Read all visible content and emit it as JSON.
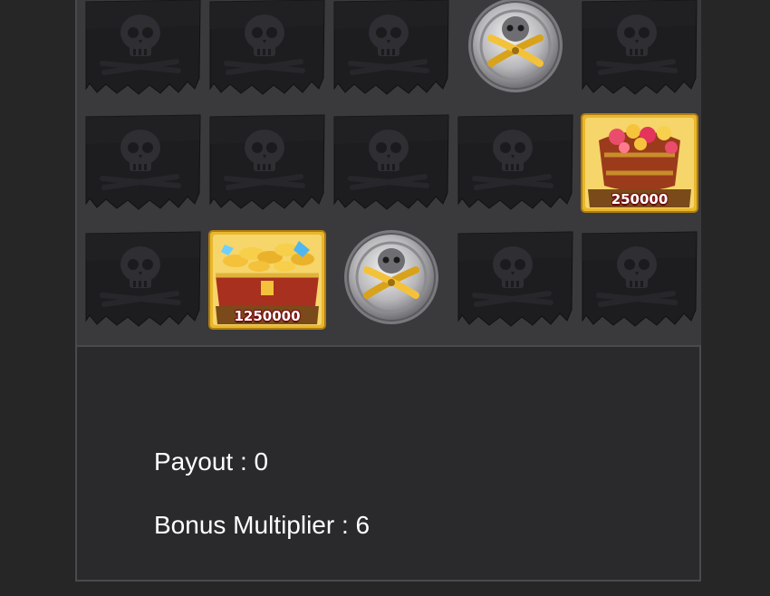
{
  "grid": {
    "rows": [
      [
        {
          "type": "skull-flag"
        },
        {
          "type": "skull-flag"
        },
        {
          "type": "skull-flag"
        },
        {
          "type": "coin"
        },
        {
          "type": "skull-flag"
        }
      ],
      [
        {
          "type": "skull-flag"
        },
        {
          "type": "skull-flag"
        },
        {
          "type": "skull-flag"
        },
        {
          "type": "skull-flag"
        },
        {
          "type": "gem-barrel",
          "value": "250000"
        }
      ],
      [
        {
          "type": "skull-flag"
        },
        {
          "type": "treasure-chest",
          "value": "1250000"
        },
        {
          "type": "coin"
        },
        {
          "type": "skull-flag"
        },
        {
          "type": "skull-flag"
        }
      ]
    ]
  },
  "info": {
    "payout": "Payout : 0",
    "bonus_multiplier": "Bonus Multiplier : 6"
  }
}
